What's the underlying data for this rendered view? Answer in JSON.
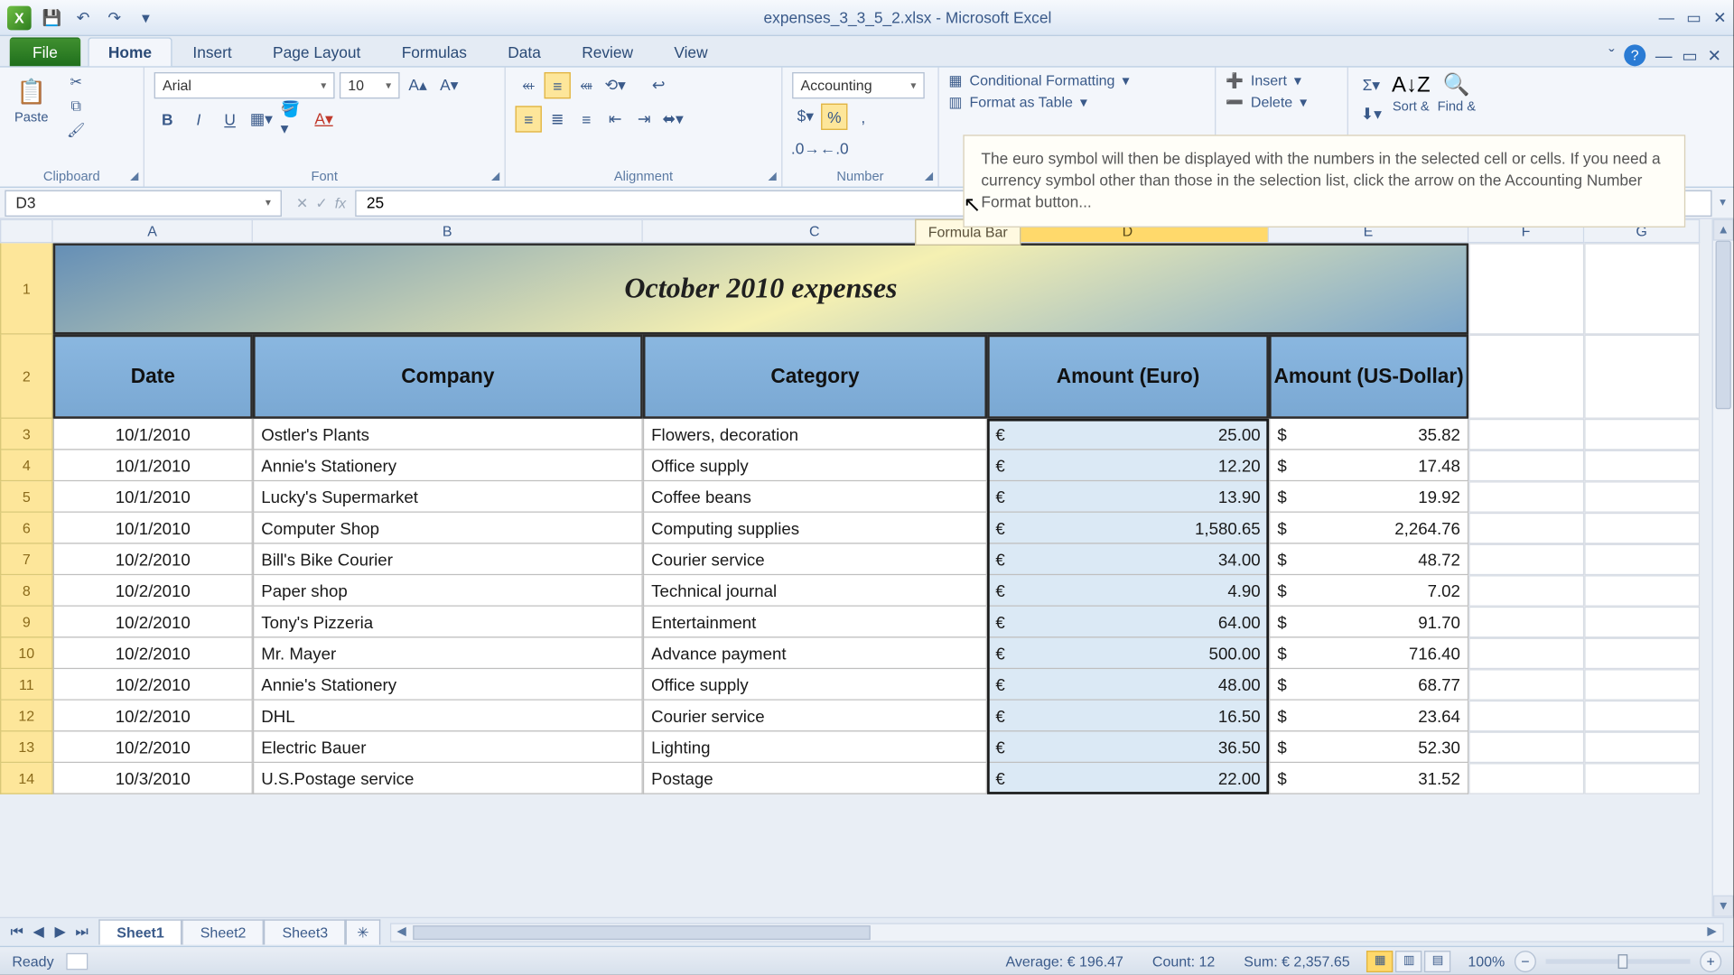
{
  "window_title": "expenses_3_3_5_2.xlsx - Microsoft Excel",
  "ribbon_tabs": {
    "file": "File",
    "home": "Home",
    "insert": "Insert",
    "page_layout": "Page Layout",
    "formulas": "Formulas",
    "data": "Data",
    "review": "Review",
    "view": "View"
  },
  "clipboard": {
    "paste": "Paste",
    "label": "Clipboard"
  },
  "font": {
    "name": "Arial",
    "size": "10",
    "label": "Font"
  },
  "alignment": {
    "label": "Alignment"
  },
  "number": {
    "format": "Accounting",
    "label": "Number"
  },
  "styles": {
    "cond": "Conditional Formatting",
    "table": "Format as Table"
  },
  "cells": {
    "insert": "Insert",
    "delete": "Delete"
  },
  "editing": {
    "sort": "Sort &",
    "find": "Find &"
  },
  "tooltip_text": "The euro symbol will then be displayed with the numbers in the selected cell or cells. If you need a currency symbol other than those in the selection list, click the arrow on the Accounting Number Format button...",
  "formula_bar_tag": "Formula Bar",
  "name_box": "D3",
  "formula_value": "25",
  "columns": [
    "A",
    "B",
    "C",
    "D",
    "E",
    "F",
    "G"
  ],
  "title_row": "October 2010 expenses",
  "headers": {
    "date": "Date",
    "company": "Company",
    "category": "Category",
    "euro": "Amount (Euro)",
    "usd": "Amount (US-Dollar)"
  },
  "rows": [
    {
      "n": "3",
      "date": "10/1/2010",
      "company": "Ostler's Plants",
      "category": "Flowers, decoration",
      "euro": "25.00",
      "usd": "35.82"
    },
    {
      "n": "4",
      "date": "10/1/2010",
      "company": "Annie's Stationery",
      "category": "Office supply",
      "euro": "12.20",
      "usd": "17.48"
    },
    {
      "n": "5",
      "date": "10/1/2010",
      "company": "Lucky's Supermarket",
      "category": "Coffee beans",
      "euro": "13.90",
      "usd": "19.92"
    },
    {
      "n": "6",
      "date": "10/1/2010",
      "company": "Computer Shop",
      "category": "Computing supplies",
      "euro": "1,580.65",
      "usd": "2,264.76"
    },
    {
      "n": "7",
      "date": "10/2/2010",
      "company": "Bill's Bike Courier",
      "category": "Courier service",
      "euro": "34.00",
      "usd": "48.72"
    },
    {
      "n": "8",
      "date": "10/2/2010",
      "company": "Paper shop",
      "category": "Technical journal",
      "euro": "4.90",
      "usd": "7.02"
    },
    {
      "n": "9",
      "date": "10/2/2010",
      "company": "Tony's Pizzeria",
      "category": "Entertainment",
      "euro": "64.00",
      "usd": "91.70"
    },
    {
      "n": "10",
      "date": "10/2/2010",
      "company": "Mr. Mayer",
      "category": "Advance payment",
      "euro": "500.00",
      "usd": "716.40"
    },
    {
      "n": "11",
      "date": "10/2/2010",
      "company": "Annie's Stationery",
      "category": "Office supply",
      "euro": "48.00",
      "usd": "68.77"
    },
    {
      "n": "12",
      "date": "10/2/2010",
      "company": "DHL",
      "category": "Courier service",
      "euro": "16.50",
      "usd": "23.64"
    },
    {
      "n": "13",
      "date": "10/2/2010",
      "company": "Electric Bauer",
      "category": "Lighting",
      "euro": "36.50",
      "usd": "52.30"
    },
    {
      "n": "14",
      "date": "10/3/2010",
      "company": "U.S.Postage service",
      "category": "Postage",
      "euro": "22.00",
      "usd": "31.52"
    }
  ],
  "sheets": {
    "s1": "Sheet1",
    "s2": "Sheet2",
    "s3": "Sheet3"
  },
  "status": {
    "ready": "Ready",
    "avg": "Average: € 196.47",
    "count": "Count: 12",
    "sum": "Sum: € 2,357.65",
    "zoom": "100%"
  }
}
